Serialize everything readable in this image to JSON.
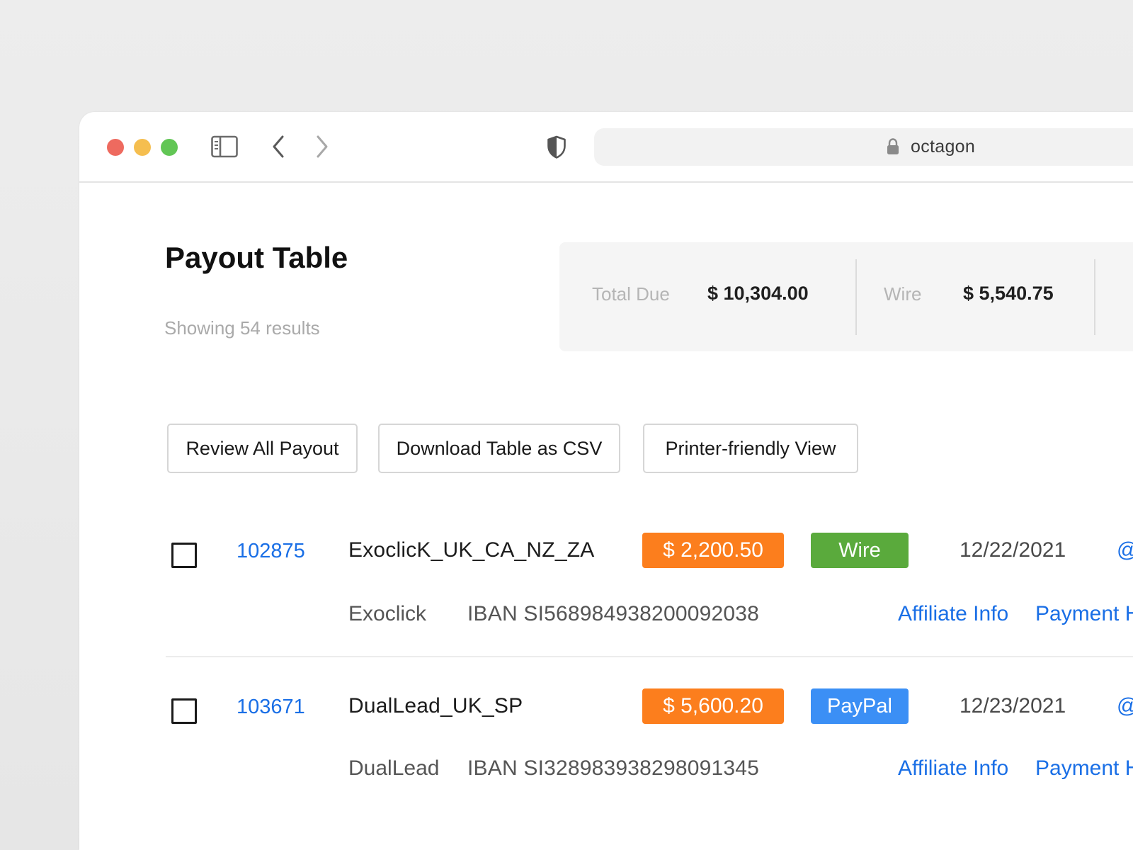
{
  "colors": {
    "traffic_red": "#ee6a5f",
    "traffic_yellow": "#f5be4f",
    "traffic_green": "#62c655",
    "link_blue": "#1a6fe6",
    "amount_orange": "#fc7e1d",
    "wire_green": "#5aaa3c",
    "paypal_blue": "#3b8ff5"
  },
  "toolbar": {
    "icons": [
      "sidebar-icon",
      "chevron-left-icon",
      "chevron-right-icon",
      "shield-icon",
      "lock-icon"
    ],
    "url": "octagon"
  },
  "page": {
    "title": "Payout Table",
    "results_text": "Showing 54 results"
  },
  "summary": {
    "total_due_label": "Total Due",
    "total_due_value": "$ 10,304.00",
    "wire_label": "Wire",
    "wire_value": "$ 5,540.75"
  },
  "actions": {
    "review_label": "Review All Payout",
    "download_label": "Download Table as CSV",
    "printer_label": "Printer-friendly View"
  },
  "rows": [
    {
      "id": "102875",
      "name": "ExoclicK_UK_CA_NZ_ZA",
      "amount": "$ 2,200.50",
      "method": "Wire",
      "date": "12/22/2021",
      "email_icon": "@",
      "affiliate": "Exoclick",
      "iban": "IBAN SI56898493820009203​8",
      "affiliate_info_label": "Affiliate Info",
      "payment_label": "Payment H"
    },
    {
      "id": "103671",
      "name": "DualLead_UK_SP",
      "amount": "$ 5,600.20",
      "method": "PayPal",
      "date": "12/23/2021",
      "email_icon": "@",
      "affiliate": "DualLead",
      "iban": "IBAN SI328983938298091345",
      "affiliate_info_label": "Affiliate Info",
      "payment_label": "Payment H"
    }
  ]
}
